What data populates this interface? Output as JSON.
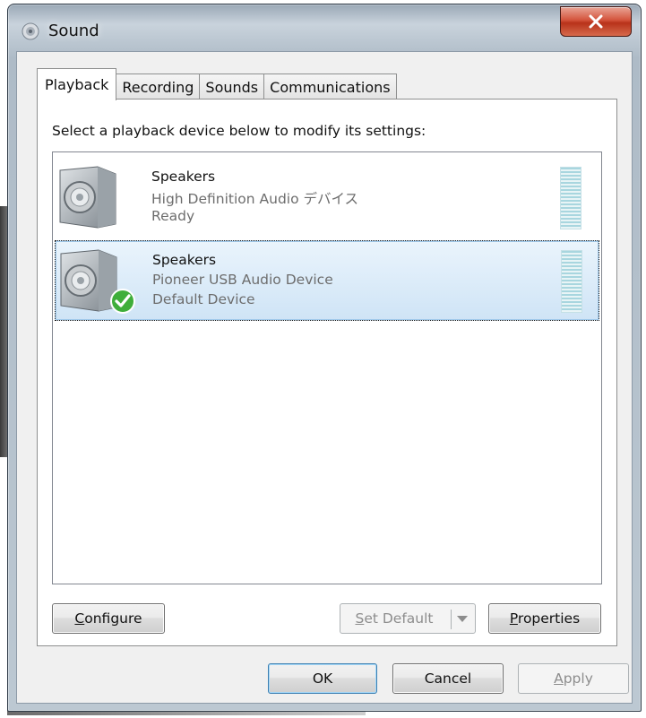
{
  "window": {
    "title": "Sound",
    "close_label": "x"
  },
  "tabs": [
    {
      "label": "Playback",
      "active": true
    },
    {
      "label": "Recording",
      "active": false
    },
    {
      "label": "Sounds",
      "active": false
    },
    {
      "label": "Communications",
      "active": false
    }
  ],
  "playback": {
    "instruction": "Select a playback device below to modify its settings:",
    "devices": [
      {
        "name": "Speakers",
        "description": "High Definition Audio デバイス",
        "status": "Ready",
        "is_default": false,
        "selected": false
      },
      {
        "name": "Speakers",
        "description": "Pioneer USB Audio Device",
        "status": "Default Device",
        "is_default": true,
        "selected": true
      }
    ],
    "configure_label": "Configure",
    "set_default_label": "Set Default",
    "properties_label": "Properties"
  },
  "dialog_buttons": {
    "ok_label": "OK",
    "cancel_label": "Cancel",
    "apply_label": "Apply"
  },
  "colors": {
    "selection": "#cfe4f6",
    "level_meter": "#a8d6df",
    "default_check": "#3fae3a",
    "close_button": "#c8432a"
  },
  "icons": {
    "title": "sound-icon",
    "device": "speaker-icon",
    "default_badge": "checkmark-icon"
  }
}
